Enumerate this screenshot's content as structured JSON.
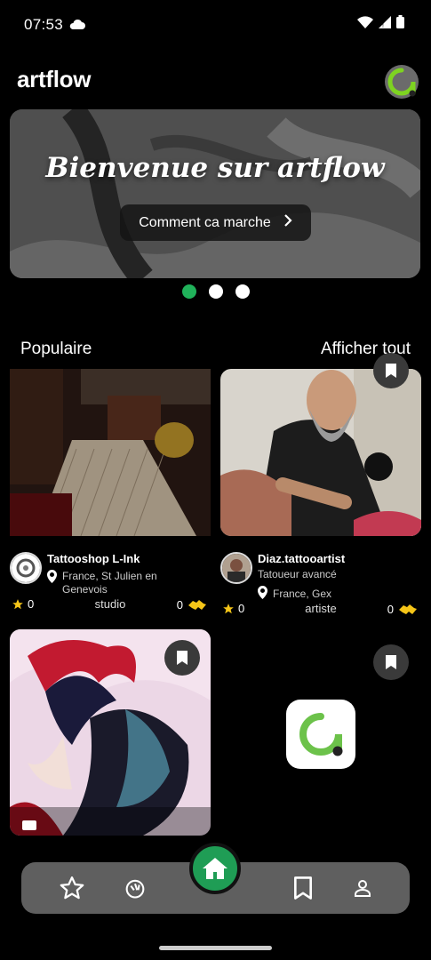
{
  "status": {
    "time": "07:53"
  },
  "header": {
    "title": "artflow"
  },
  "banner": {
    "title": "Bienvenue sur artflow",
    "button_label": "Comment ca marche"
  },
  "carousel": {
    "count": 3,
    "active": 0
  },
  "section": {
    "title": "Populaire",
    "link": "Afficher tout"
  },
  "cards": [
    {
      "name": "Tattooshop L-Ink",
      "location_line1": "France,  St Julien en",
      "location_line2": "Genevois",
      "stars": "0",
      "type": "studio",
      "swaps": "0"
    },
    {
      "name": "Diaz.tattooartist",
      "subtitle": "Tatoueur avancé",
      "location": "France,  Gex",
      "stars": "0",
      "type": "artiste",
      "swaps": "0"
    }
  ],
  "nav": {
    "items": [
      "star-icon",
      "ok-hand-icon",
      "home-icon",
      "bookmark-icon",
      "profile-icon"
    ]
  },
  "colors": {
    "accent": "#20b25a",
    "fab": "#1f9d55",
    "nav_bg": "#5f5f5f",
    "gold": "#f5c518"
  }
}
